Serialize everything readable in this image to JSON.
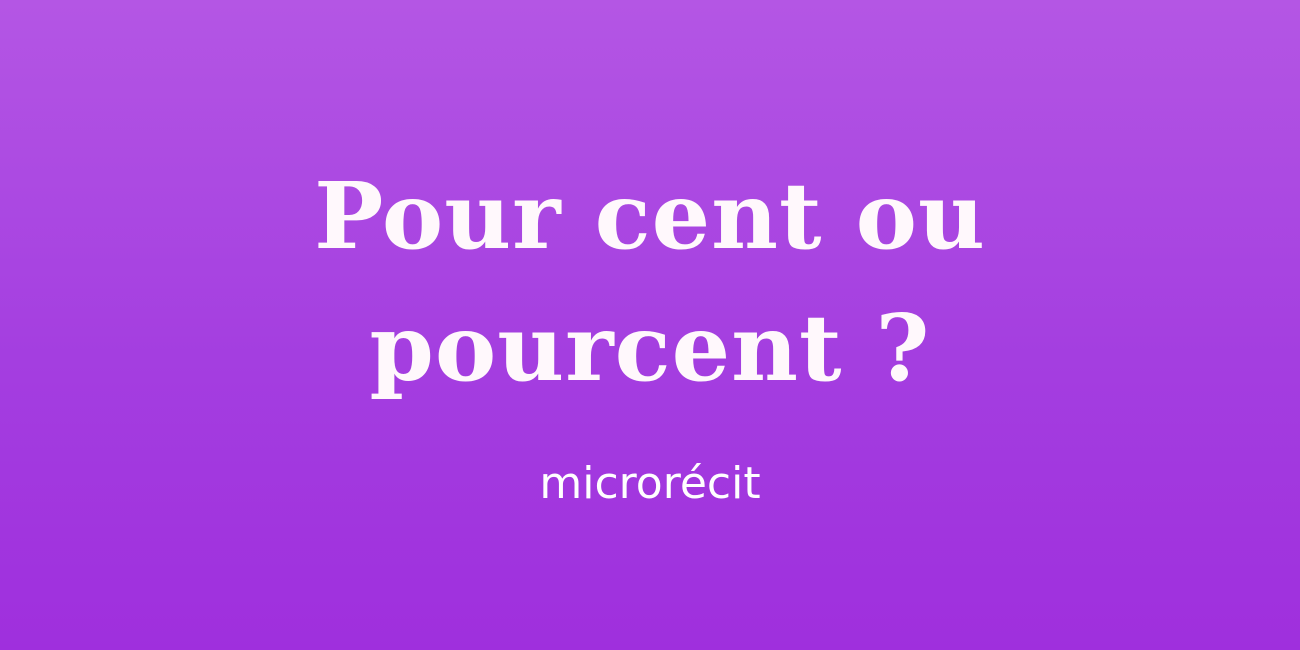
{
  "title": {
    "line1": "Pour cent ou",
    "line2": "pourcent ?"
  },
  "subtitle": "microrécit",
  "colors": {
    "background_top": "#b456e4",
    "background_bottom": "#9f2fdd",
    "text": "#fff8fc"
  }
}
